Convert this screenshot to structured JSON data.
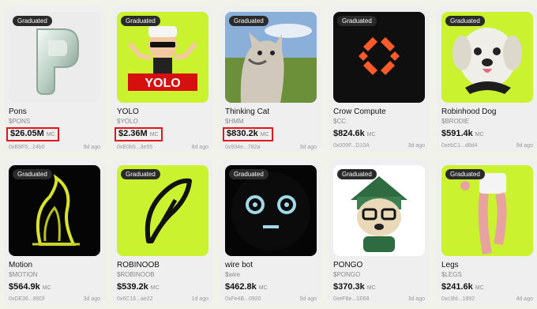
{
  "badge_text": "Graduated",
  "mc_label": "MC",
  "cards": [
    {
      "name": "Pons",
      "ticker": "$PONS",
      "mc": "$26.05M",
      "address": "0xB9F5...24b0",
      "age": "9d ago",
      "highlighted": true,
      "bg": "#ececec",
      "icon": "pons-logo-icon"
    },
    {
      "name": "YOLO",
      "ticker": "$YOLO",
      "mc": "$2.36M",
      "address": "0xE0b5...3e55",
      "age": "8d ago",
      "highlighted": true,
      "bg": "#cbf22f",
      "icon": "yolo-character-icon",
      "art_text": "YOLO"
    },
    {
      "name": "Thinking Cat",
      "ticker": "$HMM",
      "mc": "$830.2k",
      "address": "0x934e...782a",
      "age": "3d ago",
      "highlighted": true,
      "bg": "#7fa8d6",
      "icon": "thinking-cat-icon"
    },
    {
      "name": "Crow Compute",
      "ticker": "$CC",
      "mc": "$824.6k",
      "address": "0x009F...D10A",
      "age": "3d ago",
      "highlighted": false,
      "bg": "#0f0f0f",
      "icon": "crow-compute-logo-icon"
    },
    {
      "name": "Robinhood Dog",
      "ticker": "$BRODIE",
      "mc": "$591.4k",
      "address": "0xebC1...d8d4",
      "age": "9d ago",
      "highlighted": false,
      "bg": "#cbf22f",
      "icon": "robinhood-dog-icon"
    },
    {
      "name": "Motion",
      "ticker": "$MOTION",
      "mc": "$564.9k",
      "address": "0xDE36...88Df",
      "age": "3d ago",
      "highlighted": false,
      "bg": "#050505",
      "icon": "motion-liquid-icon"
    },
    {
      "name": "ROBINOOB",
      "ticker": "$ROBINOOB",
      "mc": "$539.2k",
      "address": "0x6C16...ae22",
      "age": "1d ago",
      "highlighted": false,
      "bg": "#cbf22f",
      "icon": "feather-logo-icon"
    },
    {
      "name": "wire bot",
      "ticker": "$wire",
      "mc": "$462.8k",
      "address": "0xFe4B...0920",
      "age": "5d ago",
      "highlighted": false,
      "bg": "#050505",
      "icon": "wire-bot-face-icon"
    },
    {
      "name": "PONGO",
      "ticker": "$PONGO",
      "mc": "$370.3k",
      "address": "0xeF8e...1E68",
      "age": "3d ago",
      "highlighted": false,
      "bg": "#ffffff",
      "icon": "pongo-dog-icon"
    },
    {
      "name": "Legs",
      "ticker": "$LEGS",
      "mc": "$241.6k",
      "address": "0xc3fd...1892",
      "age": "4d ago",
      "highlighted": false,
      "bg": "#cbf22f",
      "icon": "legs-icon"
    }
  ]
}
